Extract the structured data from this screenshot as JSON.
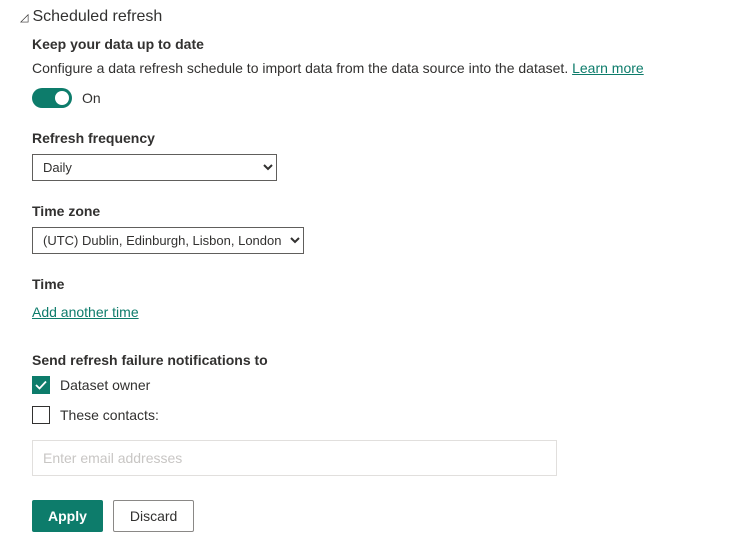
{
  "section": {
    "title": "Scheduled refresh",
    "subtitle": "Keep your data up to date",
    "description": "Configure a data refresh schedule to import data from the data source into the dataset. ",
    "learn_more": "Learn more"
  },
  "toggle": {
    "state_label": "On",
    "enabled": true
  },
  "frequency": {
    "label": "Refresh frequency",
    "value": "Daily"
  },
  "timezone": {
    "label": "Time zone",
    "value": "(UTC) Dublin, Edinburgh, Lisbon, London"
  },
  "time": {
    "label": "Time",
    "add_link": "Add another time"
  },
  "notifications": {
    "label": "Send refresh failure notifications to",
    "dataset_owner": {
      "label": "Dataset owner",
      "checked": true
    },
    "these_contacts": {
      "label": "These contacts:",
      "checked": false
    },
    "email_placeholder": "Enter email addresses"
  },
  "buttons": {
    "apply": "Apply",
    "discard": "Discard"
  }
}
